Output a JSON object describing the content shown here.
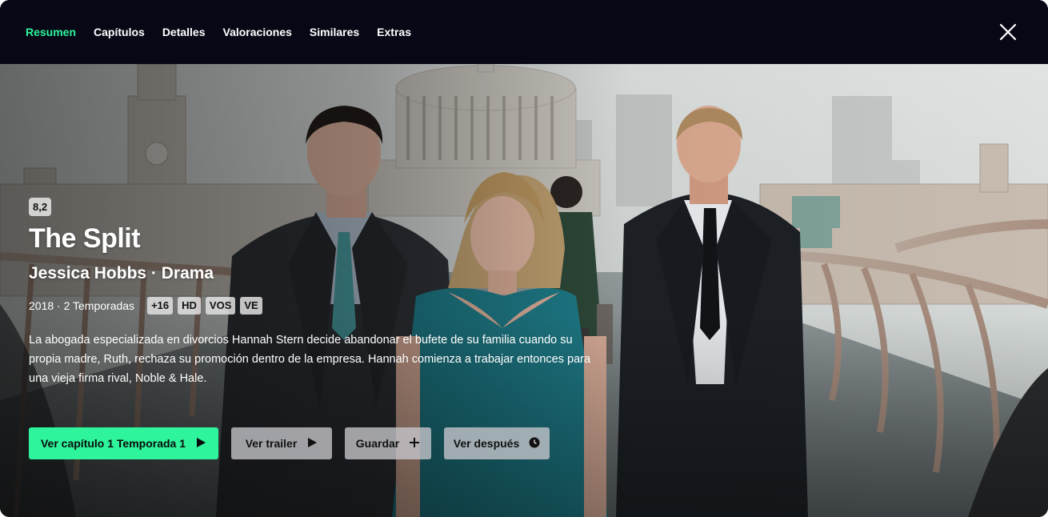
{
  "nav": {
    "tabs": [
      {
        "label": "Resumen",
        "active": true
      },
      {
        "label": "Capítulos",
        "active": false
      },
      {
        "label": "Detalles",
        "active": false
      },
      {
        "label": "Valoraciones",
        "active": false
      },
      {
        "label": "Similares",
        "active": false
      },
      {
        "label": "Extras",
        "active": false
      }
    ],
    "close_icon": "close-icon"
  },
  "show": {
    "rating": "8,2",
    "title": "The Split",
    "subtitle": "Jessica Hobbs · Drama",
    "meta": "2018 · 2 Temporadas",
    "badges": [
      "+16",
      "HD",
      "VOS",
      "VE"
    ],
    "synopsis": "La abogada especializada en divorcios Hannah Stern decide abandonar el bufete de su familia cuando su propia madre, Ruth, rechaza su promoción dentro de la empresa. Hannah comienza a trabajar entonces para una vieja firma rival, Noble & Hale."
  },
  "actions": {
    "play_label": "Ver capítulo 1 Temporada 1",
    "trailer_label": "Ver trailer",
    "save_label": "Guardar",
    "later_label": "Ver después"
  },
  "colors": {
    "accent": "#2ef59c",
    "topbar": "#070716",
    "secondary_button": "#c8c8cd"
  }
}
